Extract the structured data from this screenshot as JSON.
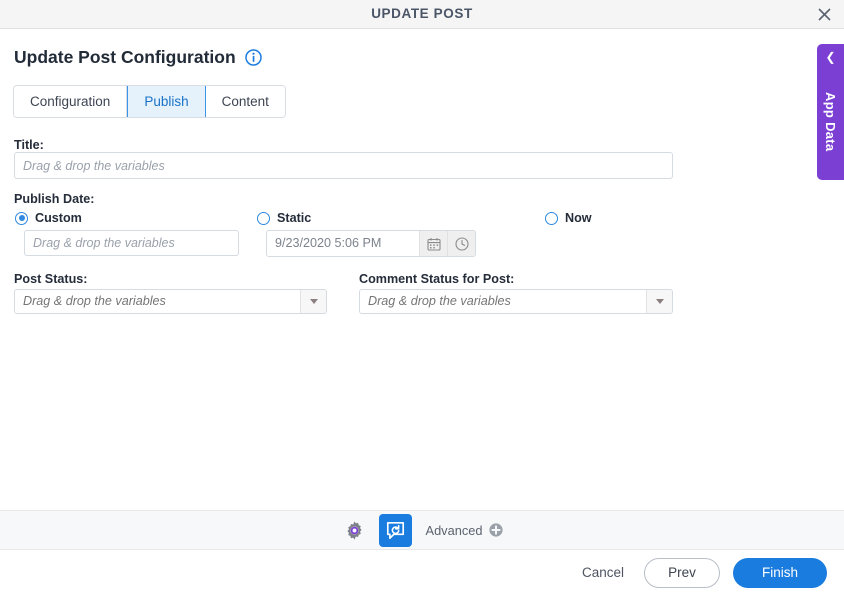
{
  "window": {
    "title": "UPDATE POST",
    "close_icon": "close-icon"
  },
  "heading": {
    "text": "Update Post Configuration",
    "info_icon": "info-circle-icon"
  },
  "tabs": [
    {
      "label": "Configuration",
      "active": false
    },
    {
      "label": "Publish",
      "active": true
    },
    {
      "label": "Content",
      "active": false
    }
  ],
  "form": {
    "title_field": {
      "label": "Title:",
      "placeholder": "Drag & drop the variables",
      "value": ""
    },
    "publish_date": {
      "label": "Publish Date:",
      "options": [
        {
          "label": "Custom",
          "selected": true
        },
        {
          "label": "Static",
          "selected": false
        },
        {
          "label": "Now",
          "selected": false
        }
      ],
      "custom_placeholder": "Drag & drop the variables",
      "custom_value": "",
      "static_value": "9/23/2020 5:06 PM",
      "calendar_icon": "calendar-icon",
      "clock_icon": "clock-icon"
    },
    "post_status": {
      "label": "Post Status:",
      "placeholder": "Drag & drop the variables",
      "value": "",
      "arrow_icon": "chevron-down-icon"
    },
    "comment_status": {
      "label": "Comment Status for Post:",
      "placeholder": "Drag & drop the variables",
      "value": "",
      "arrow_icon": "chevron-down-icon"
    }
  },
  "app_data_tab": {
    "label": "App Data",
    "chevron_icon": "chevron-left-icon"
  },
  "toolbar": {
    "settings_icon": "gear-icon",
    "refresh_comment_icon": "comment-refresh-icon",
    "advanced_label": "Advanced",
    "advanced_plus_icon": "plus-circle-icon"
  },
  "footer": {
    "cancel_label": "Cancel",
    "prev_label": "Prev",
    "finish_label": "Finish"
  },
  "colors": {
    "accent_blue": "#1b7ce0",
    "tab_active_blue": "#3a95e8",
    "purple": "#7b3fd4",
    "gear_purple": "#7b3fd4"
  }
}
